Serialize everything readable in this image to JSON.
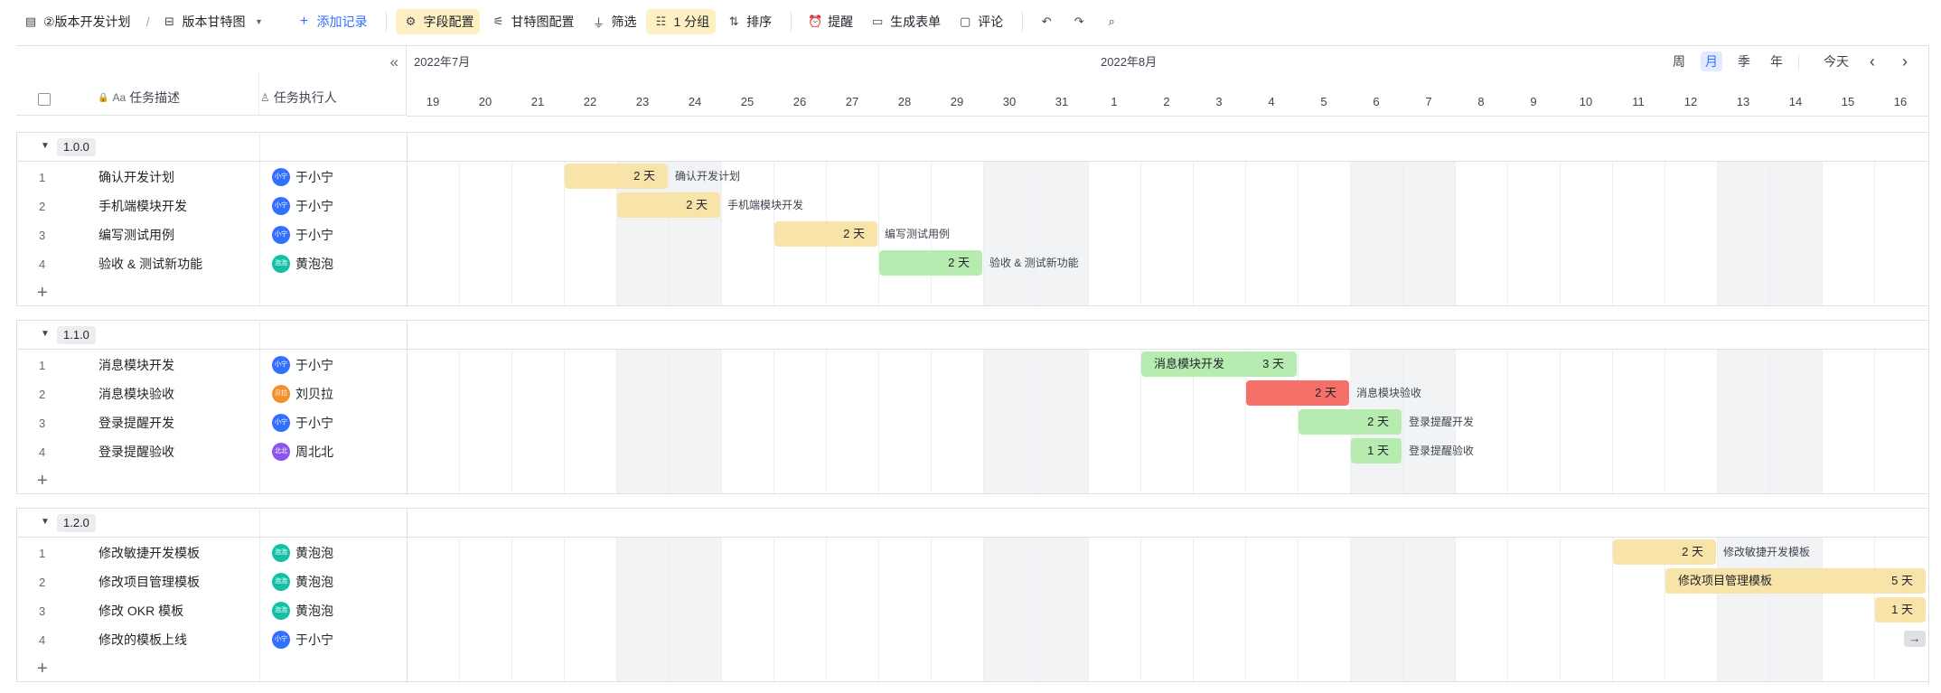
{
  "toolbar": {
    "doc_title": "②版本开发计划",
    "sep": "/",
    "view_name": "版本甘特图",
    "add_record": "添加记录",
    "field_config": "字段配置",
    "gantt_config": "甘特图配置",
    "filter": "筛选",
    "group": "1 分组",
    "sort": "排序",
    "reminder": "提醒",
    "form": "生成表单",
    "comment": "评论"
  },
  "colors": {
    "accent": "#3370ff",
    "yellow_bar": "#f8e3a8",
    "green_bar": "#b7ecb1",
    "red_bar": "#f57069",
    "highlight": "#fdf0c2"
  },
  "header": {
    "col_desc": "任务描述",
    "col_owner": "任务执行人",
    "month1": "2022年7月",
    "month2": "2022年8月",
    "zoom": [
      "周",
      "月",
      "季",
      "年"
    ],
    "today": "今天",
    "prev": "‹",
    "next": "›"
  },
  "days": [
    "19",
    "20",
    "21",
    "22",
    "23",
    "24",
    "25",
    "26",
    "27",
    "28",
    "29",
    "30",
    "31",
    "1",
    "2",
    "3",
    "4",
    "5",
    "6",
    "7",
    "8",
    "9",
    "10",
    "11",
    "12",
    "13",
    "14",
    "15",
    "16"
  ],
  "groups": [
    {
      "label": "1.0.0",
      "rows": [
        {
          "num": "1",
          "task": "确认开发计划",
          "owner": "于小宁",
          "avatar": "小宁",
          "color": "#3370ff"
        },
        {
          "num": "2",
          "task": "手机端模块开发",
          "owner": "于小宁",
          "avatar": "小宁",
          "color": "#3370ff"
        },
        {
          "num": "3",
          "task": "编写测试用例",
          "owner": "于小宁",
          "avatar": "小宁",
          "color": "#3370ff"
        },
        {
          "num": "4",
          "task": "验收 & 测试新功能",
          "owner": "黄泡泡",
          "avatar": "泡泡",
          "color": "#14c0a4"
        }
      ]
    },
    {
      "label": "1.1.0",
      "rows": [
        {
          "num": "1",
          "task": "消息模块开发",
          "owner": "于小宁",
          "avatar": "小宁",
          "color": "#3370ff"
        },
        {
          "num": "2",
          "task": "消息模块验收",
          "owner": "刘贝拉",
          "avatar": "贝拉",
          "color": "#f5902a"
        },
        {
          "num": "3",
          "task": "登录提醒开发",
          "owner": "于小宁",
          "avatar": "小宁",
          "color": "#3370ff"
        },
        {
          "num": "4",
          "task": "登录提醒验收",
          "owner": "周北北",
          "avatar": "北北",
          "color": "#8d55ed"
        }
      ]
    },
    {
      "label": "1.2.0",
      "rows": [
        {
          "num": "1",
          "task": "修改敏捷开发模板",
          "owner": "黄泡泡",
          "avatar": "泡泡",
          "color": "#14c0a4"
        },
        {
          "num": "2",
          "task": "修改项目管理模板",
          "owner": "黄泡泡",
          "avatar": "泡泡",
          "color": "#14c0a4"
        },
        {
          "num": "3",
          "task": "修改 OKR 模板",
          "owner": "黄泡泡",
          "avatar": "泡泡",
          "color": "#14c0a4"
        },
        {
          "num": "4",
          "task": "修改的模板上线",
          "owner": "于小宁",
          "avatar": "小宁",
          "color": "#3370ff"
        }
      ]
    }
  ],
  "bars": [
    {
      "group": 0,
      "row": 0,
      "start": 3,
      "days": 2,
      "dur": "2 天",
      "color": "yellow",
      "name": "确认开发计划",
      "label_inside": false
    },
    {
      "group": 0,
      "row": 1,
      "start": 4,
      "days": 2,
      "dur": "2 天",
      "color": "yellow",
      "name": "手机端模块开发",
      "label_inside": false
    },
    {
      "group": 0,
      "row": 2,
      "start": 7,
      "days": 2,
      "dur": "2 天",
      "color": "yellow",
      "name": "编写测试用例",
      "label_inside": false
    },
    {
      "group": 0,
      "row": 3,
      "start": 9,
      "days": 2,
      "dur": "2 天",
      "color": "green",
      "name": "验收 & 测试新功能",
      "label_inside": false
    },
    {
      "group": 1,
      "row": 0,
      "start": 14,
      "days": 3,
      "dur": "3 天",
      "color": "green",
      "name": "消息模块开发",
      "label_inside": true
    },
    {
      "group": 1,
      "row": 1,
      "start": 16,
      "days": 2,
      "dur": "2 天",
      "color": "red",
      "name": "消息模块验收",
      "label_inside": false
    },
    {
      "group": 1,
      "row": 2,
      "start": 17,
      "days": 2,
      "dur": "2 天",
      "color": "green",
      "name": "登录提醒开发",
      "label_inside": false
    },
    {
      "group": 1,
      "row": 3,
      "start": 18,
      "days": 1,
      "dur": "1 天",
      "color": "green",
      "name": "登录提醒验收",
      "label_inside": false
    },
    {
      "group": 2,
      "row": 0,
      "start": 23,
      "days": 2,
      "dur": "2 天",
      "color": "yellow",
      "name": "修改敏捷开发模板",
      "label_inside": false
    },
    {
      "group": 2,
      "row": 1,
      "start": 24,
      "days": 5,
      "dur": "5 天",
      "color": "yellow",
      "name": "修改项目管理模板",
      "label_inside": true
    },
    {
      "group": 2,
      "row": 2,
      "start": 28,
      "days": 1,
      "dur": "1 天",
      "color": "yellow",
      "name": "",
      "label_inside": false
    }
  ],
  "scroll_hint": "→"
}
